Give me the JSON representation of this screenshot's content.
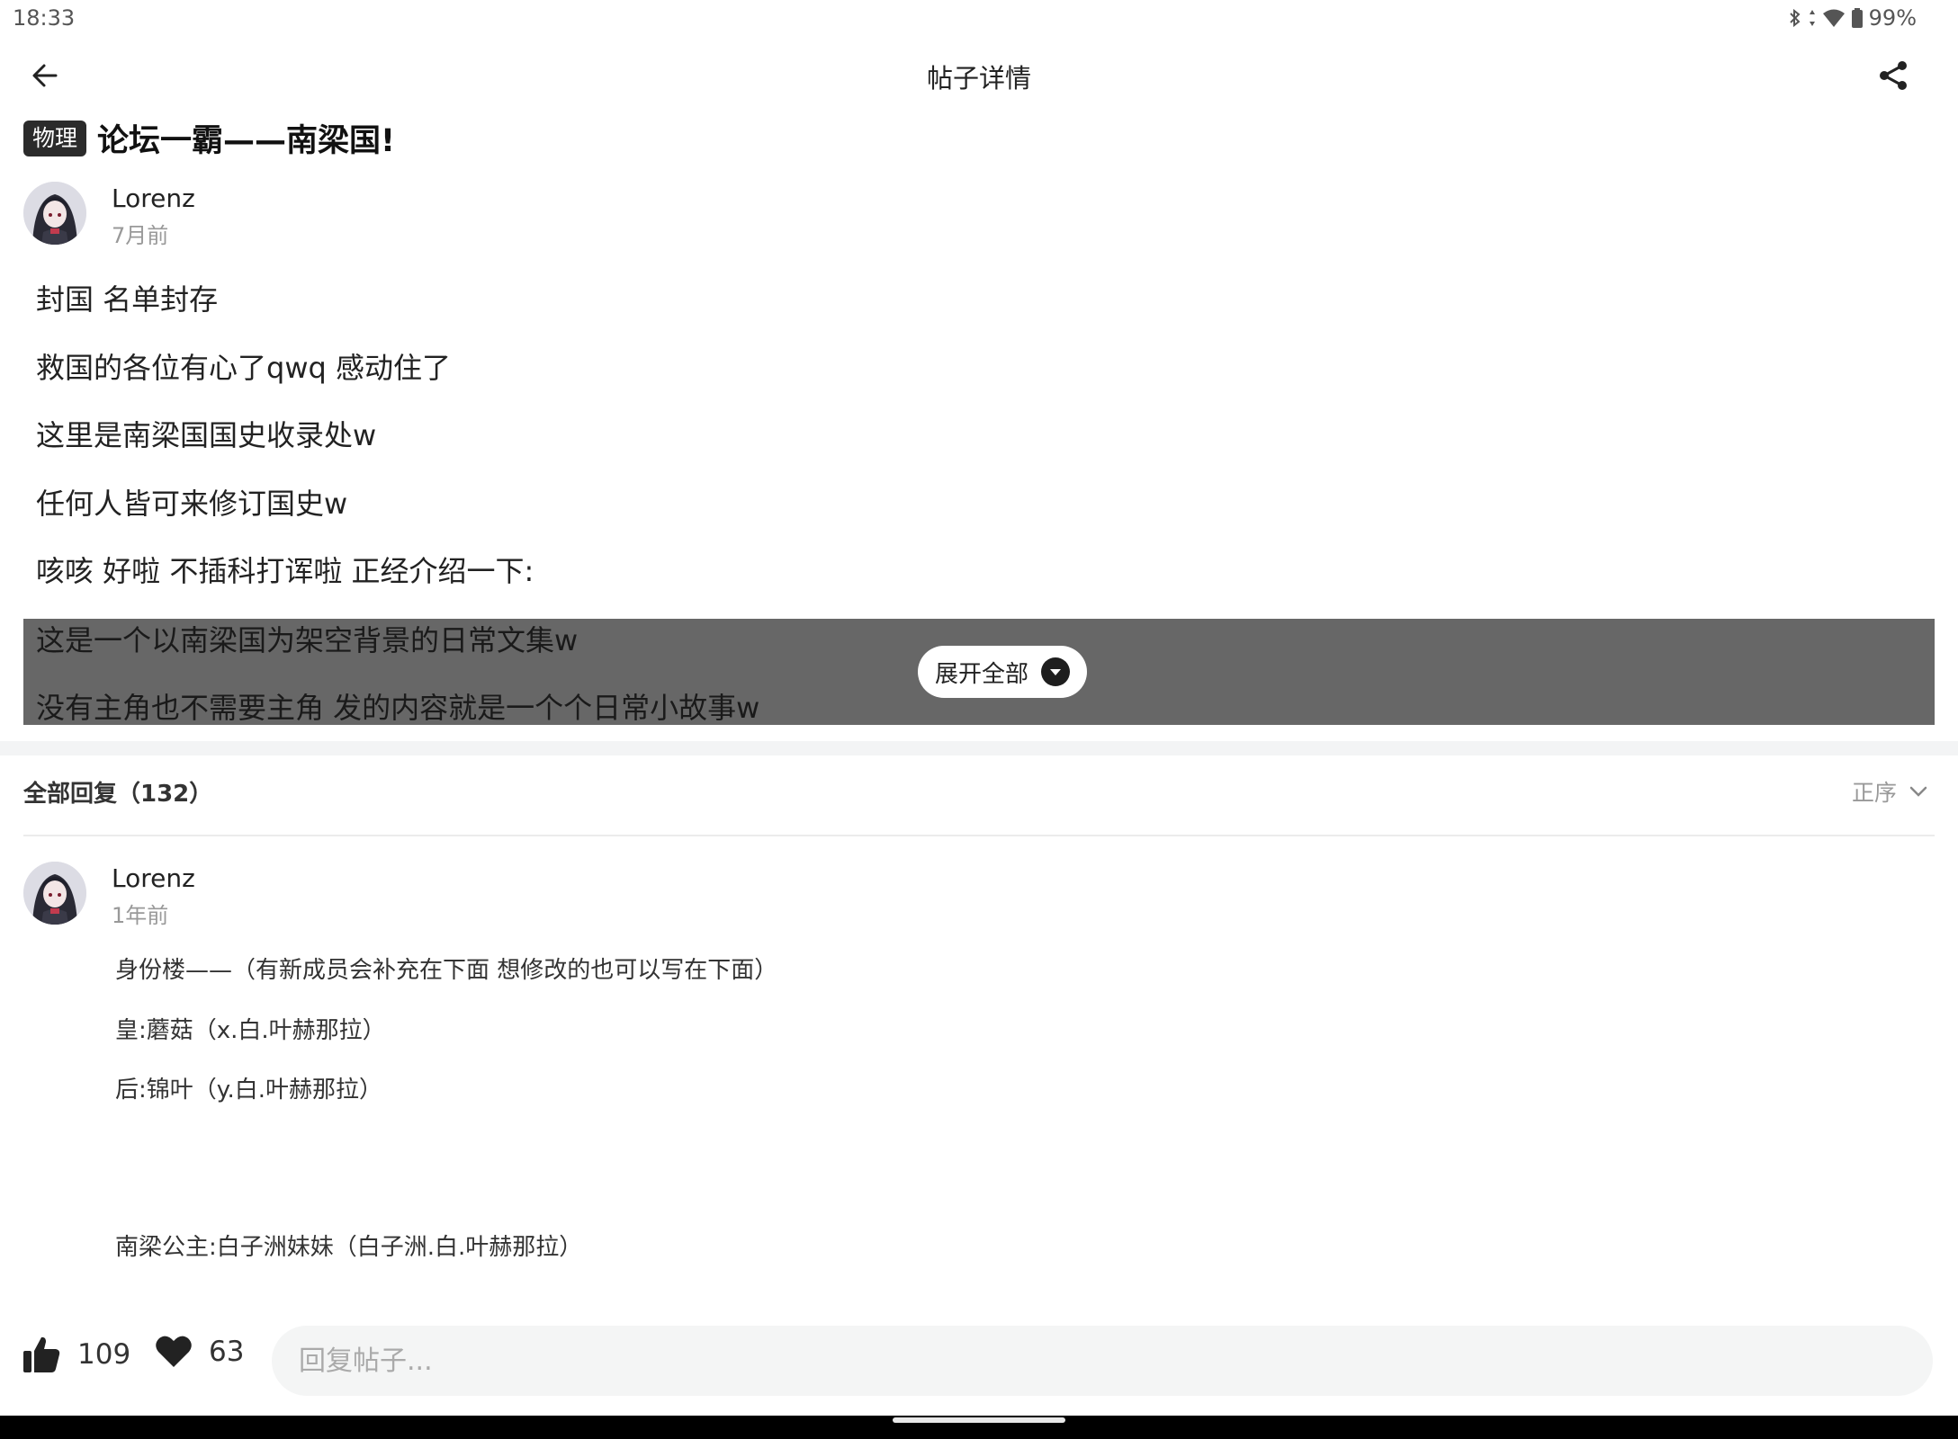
{
  "status_bar": {
    "time": "18:33",
    "battery": "99%"
  },
  "app_bar": {
    "title": "帖子详情"
  },
  "post": {
    "tag": "物理",
    "title": "论坛一霸——南梁国!",
    "author": {
      "name": "Lorenz",
      "time": "7月前"
    },
    "lines": [
      "封国 名单封存",
      "救国的各位有心了qwq 感动住了",
      "这里是南梁国国史收录处w",
      "任何人皆可来修订国史w",
      "咳咳 好啦 不插科打诨啦 正经介绍一下:"
    ],
    "folded_lines": [
      "这是一个以南梁国为架空背景的日常文集w",
      "没有主角也不需要主角 发的内容就是一个个日常小故事w"
    ],
    "expand_label": "展开全部"
  },
  "replies": {
    "title": "全部回复（132）",
    "sort_label": "正序",
    "items": [
      {
        "author": "Lorenz",
        "time": "1年前",
        "lines": [
          "身份楼——（有新成员会补充在下面 想修改的也可以写在下面）",
          "皇:蘑菇（x.白.叶赫那拉）",
          "后:锦叶（y.白.叶赫那拉）",
          "南梁公主:白子洲妹妹（白子洲.白.叶赫那拉）"
        ]
      }
    ]
  },
  "bottom_bar": {
    "like_count": "109",
    "favorite_count": "63",
    "reply_placeholder": "回复帖子..."
  }
}
